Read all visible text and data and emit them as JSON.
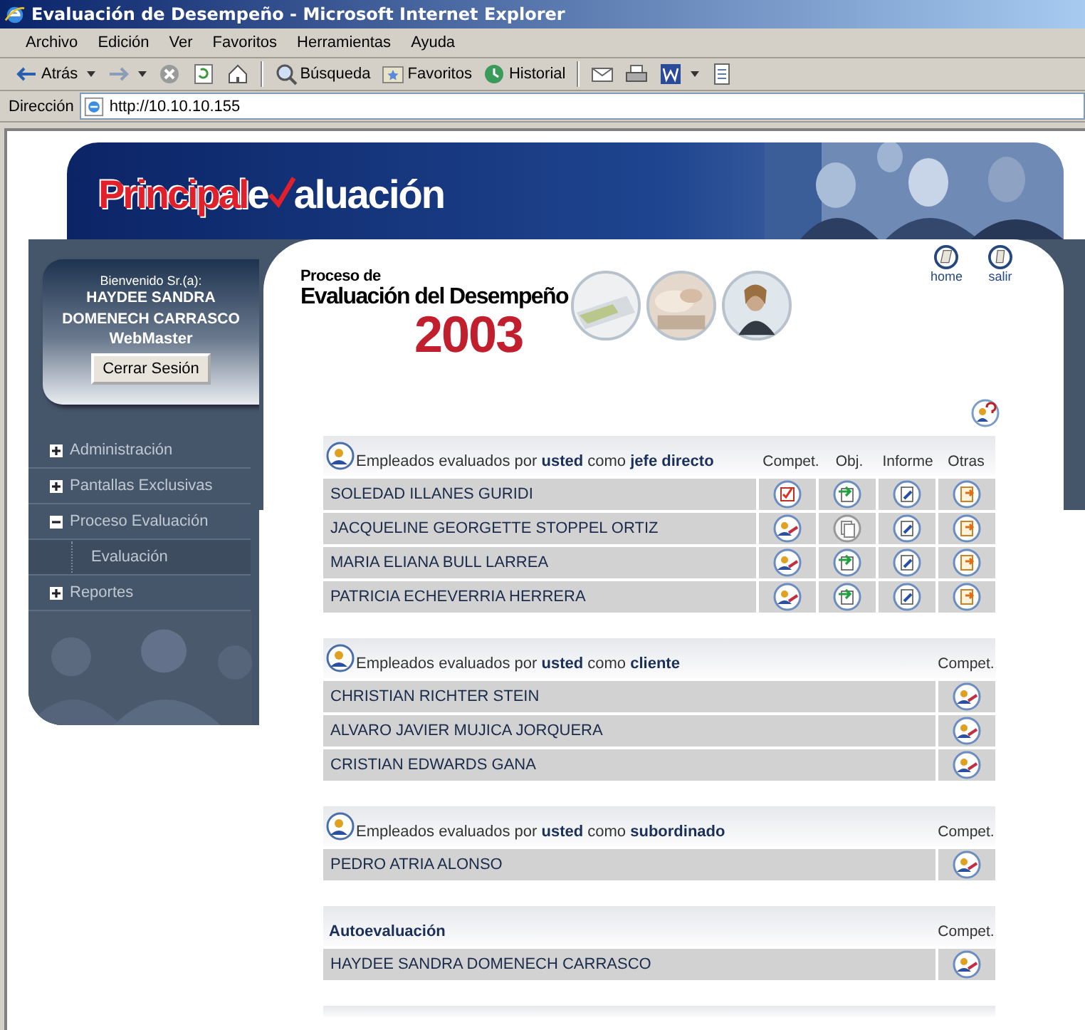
{
  "window": {
    "title": "Evaluación de Desempeño - Microsoft Internet Explorer"
  },
  "menu": [
    "Archivo",
    "Edición",
    "Ver",
    "Favoritos",
    "Herramientas",
    "Ayuda"
  ],
  "toolbar": [
    {
      "kind": "back",
      "label": "Atrás"
    },
    {
      "kind": "forward"
    },
    {
      "kind": "stop"
    },
    {
      "kind": "refresh"
    },
    {
      "kind": "home"
    },
    {
      "kind": "search",
      "label": "Búsqueda"
    },
    {
      "kind": "favorites",
      "label": "Favoritos"
    },
    {
      "kind": "history",
      "label": "Historial"
    },
    {
      "kind": "mail"
    },
    {
      "kind": "print"
    },
    {
      "kind": "word"
    },
    {
      "kind": "edit"
    }
  ],
  "address": {
    "label": "Dirección",
    "value": "http://10.10.10.155"
  },
  "logo": {
    "brand": "Principal",
    "word_start": "e",
    "word_end": "aluación"
  },
  "user": {
    "greeting": "Bienvenido Sr.(a):",
    "name": "HAYDEE SANDRA DOMENECH CARRASCO",
    "role": "WebMaster",
    "logout": "Cerrar Sesión"
  },
  "nav": [
    {
      "label": "Administración",
      "expanded": false
    },
    {
      "label": "Pantallas Exclusivas",
      "expanded": false
    },
    {
      "label": "Proceso Evaluación",
      "expanded": true,
      "children": [
        {
          "label": "Evaluación"
        }
      ]
    },
    {
      "label": "Reportes",
      "expanded": false
    }
  ],
  "header": {
    "pre": "Proceso de",
    "title": "Evaluación del Desempeño",
    "year": "2003",
    "links": [
      {
        "kind": "home",
        "label": "home"
      },
      {
        "kind": "exit",
        "label": "salir"
      }
    ]
  },
  "sections": [
    {
      "kind": "group",
      "title": "Empleados evaluados por **usted** como **jefe directo**",
      "columns": [
        "Compet.",
        "Obj.",
        "Informe",
        "Otras"
      ],
      "rows": [
        {
          "name": "SOLEDAD ILLANES GURIDI",
          "cells": [
            {
              "kind": "check"
            },
            {
              "kind": "goals"
            },
            {
              "kind": "report"
            },
            {
              "kind": "other"
            }
          ]
        },
        {
          "name": "JACQUELINE GEORGETTE STOPPEL ORTIZ",
          "cells": [
            {
              "kind": "evaluate"
            },
            {
              "kind": "pending"
            },
            {
              "kind": "report"
            },
            {
              "kind": "other"
            }
          ]
        },
        {
          "name": "MARIA ELIANA BULL LARREA",
          "cells": [
            {
              "kind": "evaluate"
            },
            {
              "kind": "goals"
            },
            {
              "kind": "report"
            },
            {
              "kind": "other"
            }
          ]
        },
        {
          "name": "PATRICIA ECHEVERRIA HERRERA",
          "cells": [
            {
              "kind": "evaluate"
            },
            {
              "kind": "goals"
            },
            {
              "kind": "report"
            },
            {
              "kind": "other"
            }
          ]
        }
      ]
    },
    {
      "kind": "group",
      "title": "Empleados evaluados por **usted** como **cliente**",
      "columns": [
        "Compet."
      ],
      "rows": [
        {
          "name": "CHRISTIAN RICHTER STEIN",
          "cells": [
            {
              "kind": "evaluate"
            }
          ]
        },
        {
          "name": "ALVARO JAVIER MUJICA JORQUERA",
          "cells": [
            {
              "kind": "evaluate"
            }
          ]
        },
        {
          "name": "CRISTIAN EDWARDS GANA",
          "cells": [
            {
              "kind": "evaluate"
            }
          ]
        }
      ]
    },
    {
      "kind": "group",
      "title": "Empleados evaluados por **usted** como **subordinado**",
      "columns": [
        "Compet."
      ],
      "rows": [
        {
          "name": "PEDRO ATRIA ALONSO",
          "cells": [
            {
              "kind": "evaluate"
            }
          ]
        }
      ]
    },
    {
      "kind": "self",
      "title": "Autoevaluación",
      "columns": [
        "Compet."
      ],
      "rows": [
        {
          "name": "HAYDEE SANDRA DOMENECH CARRASCO",
          "cells": [
            {
              "kind": "evaluate"
            }
          ]
        }
      ]
    }
  ]
}
